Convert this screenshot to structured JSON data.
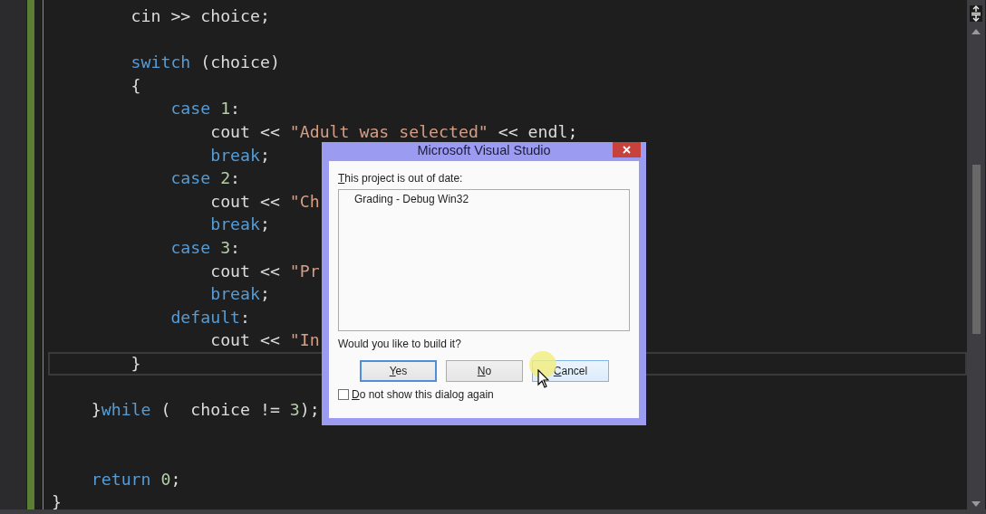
{
  "editor": {
    "lines": [
      {
        "kind": "code",
        "current": false,
        "tokens": [
          {
            "kind": "plain",
            "text": "        cin >> choice;"
          }
        ]
      },
      {
        "kind": "blank"
      },
      {
        "kind": "code",
        "current": false,
        "tokens": [
          {
            "kind": "keyword",
            "text": "        switch"
          },
          {
            "kind": "plain",
            "text": " (choice)"
          }
        ]
      },
      {
        "kind": "code",
        "current": false,
        "tokens": [
          {
            "kind": "plain",
            "text": "        {"
          }
        ]
      },
      {
        "kind": "code",
        "current": false,
        "tokens": [
          {
            "kind": "keyword",
            "text": "            case"
          },
          {
            "kind": "number",
            "text": " 1"
          },
          {
            "kind": "plain",
            "text": ":"
          }
        ]
      },
      {
        "kind": "code",
        "current": false,
        "tokens": [
          {
            "kind": "plain",
            "text": "                cout << "
          },
          {
            "kind": "string",
            "text": "\"Adult was selected\""
          },
          {
            "kind": "plain",
            "text": " << endl;"
          }
        ]
      },
      {
        "kind": "code",
        "current": false,
        "tokens": [
          {
            "kind": "keyword",
            "text": "                break"
          },
          {
            "kind": "plain",
            "text": ";"
          }
        ]
      },
      {
        "kind": "code",
        "current": false,
        "tokens": [
          {
            "kind": "keyword",
            "text": "            case"
          },
          {
            "kind": "number",
            "text": " 2"
          },
          {
            "kind": "plain",
            "text": ":"
          }
        ]
      },
      {
        "kind": "code",
        "current": false,
        "tokens": [
          {
            "kind": "plain",
            "text": "                cout << "
          },
          {
            "kind": "string",
            "text": "\"Ch"
          }
        ]
      },
      {
        "kind": "code",
        "current": false,
        "tokens": [
          {
            "kind": "keyword",
            "text": "                break"
          },
          {
            "kind": "plain",
            "text": ";"
          }
        ]
      },
      {
        "kind": "code",
        "current": false,
        "tokens": [
          {
            "kind": "keyword",
            "text": "            case"
          },
          {
            "kind": "number",
            "text": " 3"
          },
          {
            "kind": "plain",
            "text": ":"
          }
        ]
      },
      {
        "kind": "code",
        "current": false,
        "tokens": [
          {
            "kind": "plain",
            "text": "                cout << "
          },
          {
            "kind": "string",
            "text": "\"Pr"
          }
        ]
      },
      {
        "kind": "code",
        "current": false,
        "tokens": [
          {
            "kind": "keyword",
            "text": "                break"
          },
          {
            "kind": "plain",
            "text": ";"
          }
        ]
      },
      {
        "kind": "code",
        "current": false,
        "tokens": [
          {
            "kind": "keyword",
            "text": "            default"
          },
          {
            "kind": "plain",
            "text": ":"
          }
        ]
      },
      {
        "kind": "code",
        "current": false,
        "tokens": [
          {
            "kind": "plain",
            "text": "                cout << "
          },
          {
            "kind": "string",
            "text": "\"In"
          }
        ]
      },
      {
        "kind": "code",
        "current": true,
        "tokens": [
          {
            "kind": "plain",
            "text": "        }"
          }
        ]
      },
      {
        "kind": "blank"
      },
      {
        "kind": "code",
        "current": false,
        "tokens": [
          {
            "kind": "plain",
            "text": "    }"
          },
          {
            "kind": "keyword",
            "text": "while"
          },
          {
            "kind": "plain",
            "text": " (  choice != "
          },
          {
            "kind": "number",
            "text": "3"
          },
          {
            "kind": "plain",
            "text": ");"
          }
        ]
      },
      {
        "kind": "blank"
      },
      {
        "kind": "blank"
      },
      {
        "kind": "code",
        "current": false,
        "tokens": [
          {
            "kind": "keyword",
            "text": "    return"
          },
          {
            "kind": "number",
            "text": " 0"
          },
          {
            "kind": "plain",
            "text": ";"
          }
        ]
      },
      {
        "kind": "code",
        "current": false,
        "tokens": [
          {
            "kind": "plain",
            "text": "}"
          }
        ]
      }
    ]
  },
  "dialog": {
    "title": "Microsoft Visual Studio",
    "message": "This project is out of date:",
    "projects": [
      "Grading - Debug Win32"
    ],
    "question": "Would you like to build it?",
    "buttons": [
      {
        "label": "Yes",
        "default": true,
        "hovered": false
      },
      {
        "label": "No",
        "default": false,
        "hovered": false
      },
      {
        "label": "Cancel",
        "default": false,
        "hovered": true
      }
    ],
    "checkbox": {
      "label": "Do not show this dialog again",
      "checked": false
    }
  }
}
